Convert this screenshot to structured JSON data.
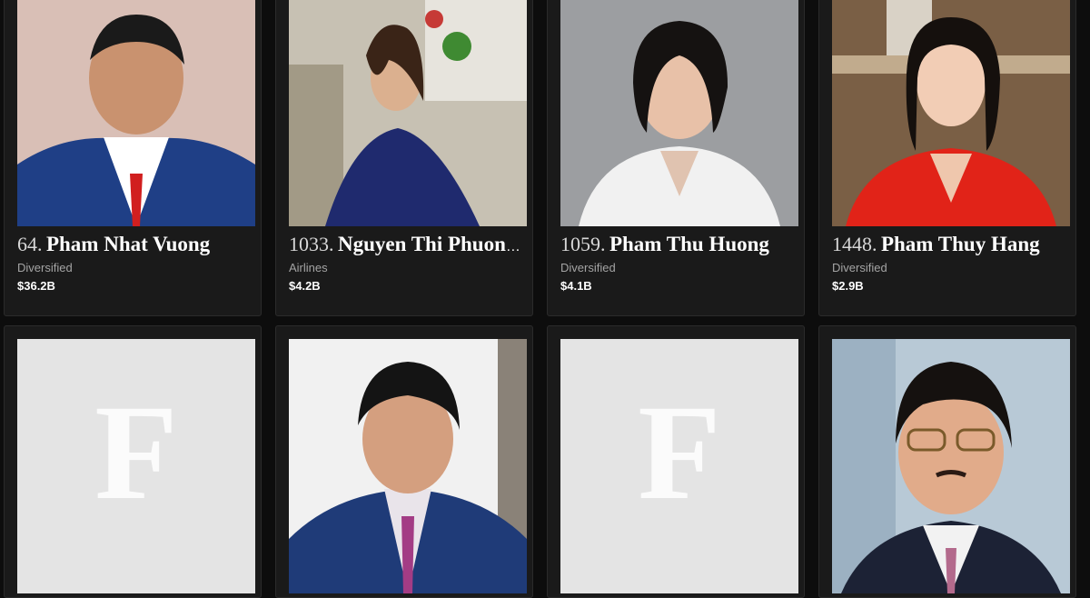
{
  "people": [
    {
      "rank": "64.",
      "name": "Pham Nhat Vuong",
      "industry": "Diversified",
      "net_worth": "$36.2B"
    },
    {
      "rank": "1033.",
      "name": "Nguyen Thi Phuong Thao",
      "industry": "Airlines",
      "net_worth": "$4.2B"
    },
    {
      "rank": "1059.",
      "name": "Pham Thu Huong",
      "industry": "Diversified",
      "net_worth": "$4.1B"
    },
    {
      "rank": "1448.",
      "name": "Pham Thuy Hang",
      "industry": "Diversified",
      "net_worth": "$2.9B"
    }
  ],
  "placeholder_logo": "F",
  "colors": {
    "page_bg": "#0d0d0d",
    "card_bg": "#1a1a1a",
    "card_border": "#2b2b2b",
    "muted_text": "#a4a4a4",
    "placeholder_bg": "#e4e4e4"
  }
}
